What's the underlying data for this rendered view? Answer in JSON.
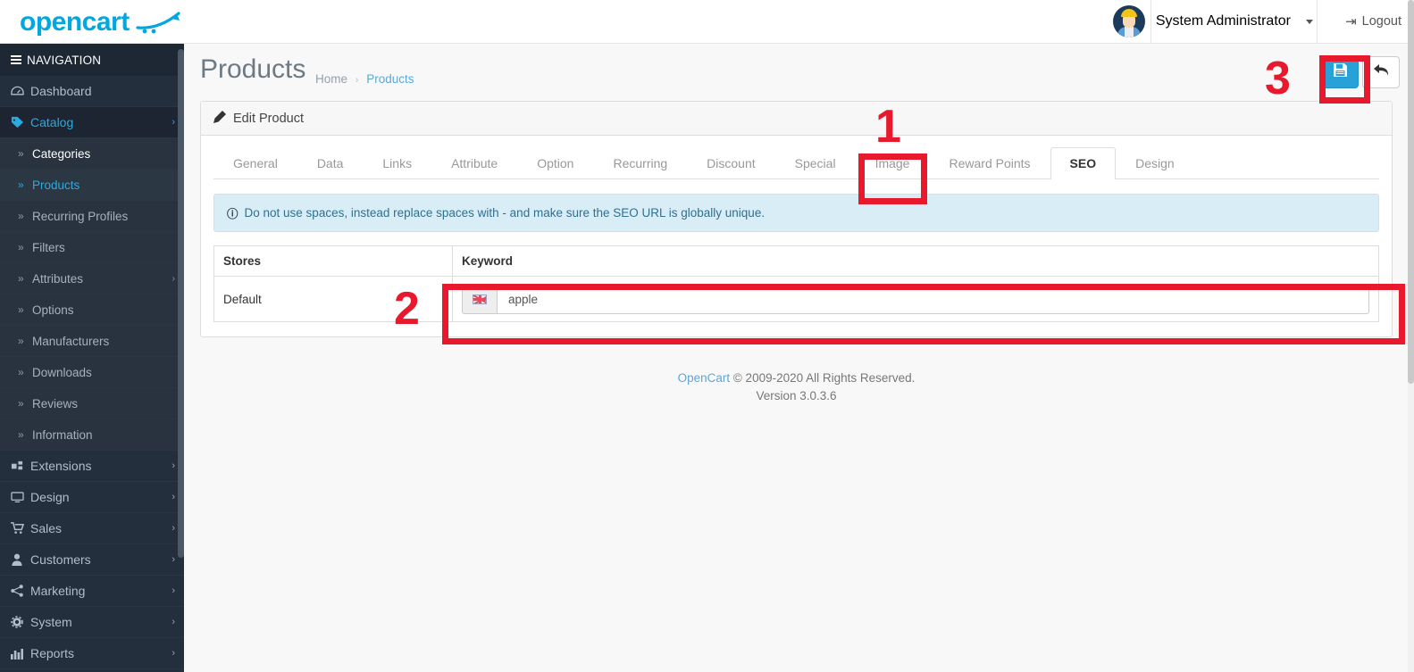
{
  "brand": {
    "name": "opencart",
    "logo_color": "#00a7e1"
  },
  "topbar": {
    "user_name": "System Administrator",
    "logout_label": "Logout",
    "avatar_name": "avatar"
  },
  "sidebar": {
    "header_label": "NAVIGATION",
    "items": [
      {
        "label": "Dashboard",
        "icon": "dashboard-icon",
        "glyph": "◔",
        "arrow": "",
        "type": "top"
      },
      {
        "label": "Catalog",
        "icon": "tag-icon",
        "glyph": "🏷",
        "arrow": "›",
        "type": "top",
        "state": "active"
      },
      {
        "label": "Categories",
        "icon": "chevron-double-right-icon",
        "glyph": "»",
        "arrow": "",
        "type": "sub",
        "state": "current"
      },
      {
        "label": "Products",
        "icon": "chevron-double-right-icon",
        "glyph": "»",
        "arrow": "",
        "type": "sub",
        "state": "selected"
      },
      {
        "label": "Recurring Profiles",
        "icon": "chevron-double-right-icon",
        "glyph": "»",
        "arrow": "",
        "type": "sub"
      },
      {
        "label": "Filters",
        "icon": "chevron-double-right-icon",
        "glyph": "»",
        "arrow": "",
        "type": "sub"
      },
      {
        "label": "Attributes",
        "icon": "chevron-double-right-icon",
        "glyph": "»",
        "arrow": "›",
        "type": "sub"
      },
      {
        "label": "Options",
        "icon": "chevron-double-right-icon",
        "glyph": "»",
        "arrow": "",
        "type": "sub"
      },
      {
        "label": "Manufacturers",
        "icon": "chevron-double-right-icon",
        "glyph": "»",
        "arrow": "",
        "type": "sub"
      },
      {
        "label": "Downloads",
        "icon": "chevron-double-right-icon",
        "glyph": "»",
        "arrow": "",
        "type": "sub"
      },
      {
        "label": "Reviews",
        "icon": "chevron-double-right-icon",
        "glyph": "»",
        "arrow": "",
        "type": "sub"
      },
      {
        "label": "Information",
        "icon": "chevron-double-right-icon",
        "glyph": "»",
        "arrow": "",
        "type": "sub"
      },
      {
        "label": "Extensions",
        "icon": "puzzle-icon",
        "glyph": "⚙",
        "arrow": "›",
        "type": "top"
      },
      {
        "label": "Design",
        "icon": "monitor-icon",
        "glyph": "▢",
        "arrow": "›",
        "type": "top"
      },
      {
        "label": "Sales",
        "icon": "cart-icon",
        "glyph": "🛒",
        "arrow": "›",
        "type": "top"
      },
      {
        "label": "Customers",
        "icon": "user-icon",
        "glyph": "👤",
        "arrow": "›",
        "type": "top"
      },
      {
        "label": "Marketing",
        "icon": "share-icon",
        "glyph": "⑂",
        "arrow": "›",
        "type": "top"
      },
      {
        "label": "System",
        "icon": "gear-icon",
        "glyph": "⚙",
        "arrow": "›",
        "type": "top"
      },
      {
        "label": "Reports",
        "icon": "bar-chart-icon",
        "glyph": "📊",
        "arrow": "›",
        "type": "top"
      }
    ]
  },
  "page": {
    "title": "Products",
    "breadcrumb_home": "Home",
    "breadcrumb_sep": "›",
    "breadcrumb_current": "Products",
    "save_icon": "save-icon",
    "back_icon": "reply-icon"
  },
  "panel": {
    "heading": "Edit Product",
    "tabs": [
      {
        "label": "General",
        "active": false
      },
      {
        "label": "Data",
        "active": false
      },
      {
        "label": "Links",
        "active": false
      },
      {
        "label": "Attribute",
        "active": false
      },
      {
        "label": "Option",
        "active": false
      },
      {
        "label": "Recurring",
        "active": false
      },
      {
        "label": "Discount",
        "active": false
      },
      {
        "label": "Special",
        "active": false
      },
      {
        "label": "Image",
        "active": false
      },
      {
        "label": "Reward Points",
        "active": false
      },
      {
        "label": "SEO",
        "active": true
      },
      {
        "label": "Design",
        "active": false
      }
    ],
    "alert": "Do not use spaces, instead replace spaces with - and make sure the SEO URL is globally unique.",
    "table": {
      "headers": [
        "Stores",
        "Keyword"
      ],
      "rows": [
        {
          "store": "Default",
          "keyword_value": "apple",
          "keyword_placeholder": "",
          "flag": "en-gb-flag-icon"
        }
      ]
    }
  },
  "footer": {
    "link_text": "OpenCart",
    "copyright": " © 2009-2020 All Rights Reserved.",
    "version": "Version 3.0.3.6"
  },
  "annotations": [
    {
      "number": "1",
      "target": "seo-tab"
    },
    {
      "number": "2",
      "target": "keyword-input-row"
    },
    {
      "number": "3",
      "target": "save-button"
    }
  ]
}
